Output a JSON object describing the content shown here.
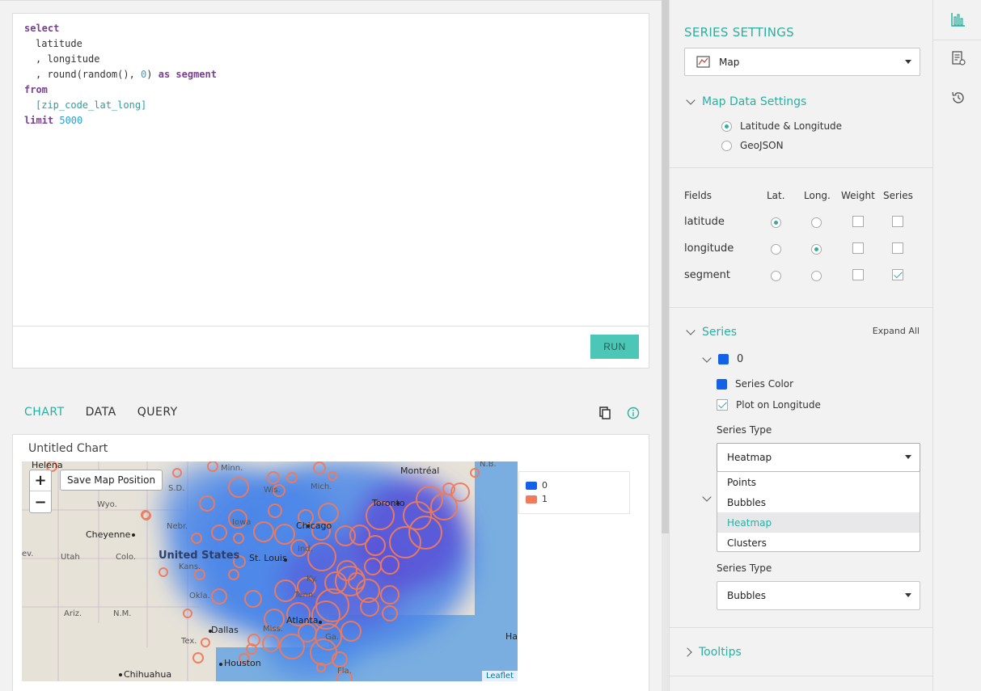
{
  "editor": {
    "run_label": "RUN",
    "code_lines": [
      "select",
      "latitude",
      ", longitude",
      ", round(random(), 0) as segment",
      "from",
      "[zip_code_lat_long]",
      "limit 5000"
    ]
  },
  "result_tabs": [
    {
      "label": "CHART",
      "active": true
    },
    {
      "label": "DATA",
      "active": false
    },
    {
      "label": "QUERY",
      "active": false
    }
  ],
  "chart": {
    "title": "Untitled Chart",
    "zoom_in": "+",
    "zoom_out": "−",
    "save_position_label": "Save Map Position",
    "attribution": "Leaflet",
    "legend": [
      {
        "name": "0",
        "color": "#1560e8"
      },
      {
        "name": "1",
        "color": "#f07a5a"
      }
    ],
    "map_labels": {
      "helena": "Helena",
      "minn": "Minn.",
      "sd": "S.D.",
      "wyo": "Wyo.",
      "nebr": "Nebr.",
      "iowa": "Iowa",
      "wis": "Wis.",
      "mich": "Mich.",
      "montreal": "Montréal",
      "nb": "N.B.",
      "toronto": "Toronto",
      "cheyenne": "Cheyenne",
      "chicago": "Chicago",
      "ind": "Ind.",
      "ev": "ev.",
      "utah": "Utah",
      "colo": "Colo.",
      "united_states": "United States",
      "st_louis": "St. Louis",
      "kans": "Kans.",
      "okla": "Okla.",
      "ky": "Ky.",
      "tenn": "Tenn.",
      "ariz": "Ariz.",
      "nm": "N.M.",
      "dallas": "Dallas",
      "atlanta": "Atlanta",
      "miss": "Miss.",
      "tex": "Tex.",
      "ga": "Ga.",
      "houston": "Houston",
      "chihuahua": "Chihuahua",
      "fla": "Fla.",
      "ha": "Ha"
    }
  },
  "panel": {
    "title": "SERIES SETTINGS",
    "chart_type": "Map",
    "map_data_settings": {
      "label": "Map Data Settings",
      "options": [
        {
          "label": "Latitude & Longitude",
          "selected": true
        },
        {
          "label": "GeoJSON",
          "selected": false
        }
      ]
    },
    "fields": {
      "header": "Fields",
      "columns": [
        "Lat.",
        "Long.",
        "Weight",
        "Series"
      ],
      "rows": [
        {
          "name": "latitude",
          "lat": true,
          "long": false,
          "weight": false,
          "series": false
        },
        {
          "name": "longitude",
          "lat": false,
          "long": true,
          "weight": false,
          "series": false
        },
        {
          "name": "segment",
          "lat": false,
          "long": false,
          "weight": false,
          "series": true
        }
      ]
    },
    "series": {
      "label": "Series",
      "expand_all": "Expand All",
      "series0": {
        "name": "0",
        "color_label": "Series Color",
        "plot_on_longitude_label": "Plot on Longitude",
        "plot_on_longitude": true,
        "type_label": "Series Type",
        "type_value": "Heatmap",
        "type_options": [
          "Points",
          "Bubbles",
          "Heatmap",
          "Clusters"
        ]
      },
      "series1": {
        "type_label": "Series Type",
        "type_value": "Bubbles"
      }
    },
    "tooltips": {
      "label": "Tooltips"
    }
  },
  "colors": {
    "accent": "#2ab0a0",
    "series0": "#1560e8",
    "series1": "#f07a5a"
  }
}
